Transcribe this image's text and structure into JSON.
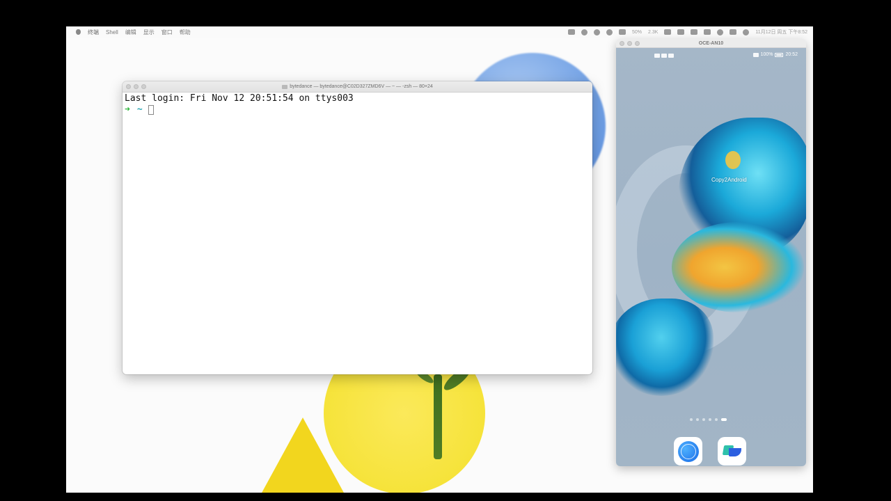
{
  "menubar": {
    "items": [
      "终端",
      "Shell",
      "编辑",
      "显示",
      "窗口",
      "帮助"
    ],
    "status_text": {
      "cpu": "50%",
      "net": "2.3K",
      "datetime": "11月12日 周五 下午8:52"
    }
  },
  "terminal": {
    "title": "bytedance — bytedance@C02D327ZMD6V — ~ — -zsh — 80×24",
    "last_login": "Last login: Fri Nov 12 20:51:54 on ttys003",
    "prompt_arrow": "➜",
    "prompt_dir": "~"
  },
  "phone": {
    "window_title": "OCE-AN10",
    "battery": "100%",
    "time": "20:52",
    "app_label": "Copy2Android",
    "page_count": 6,
    "active_page": 6,
    "dock": [
      {
        "icon": "browser-icon"
      },
      {
        "icon": "lark-icon"
      }
    ]
  }
}
